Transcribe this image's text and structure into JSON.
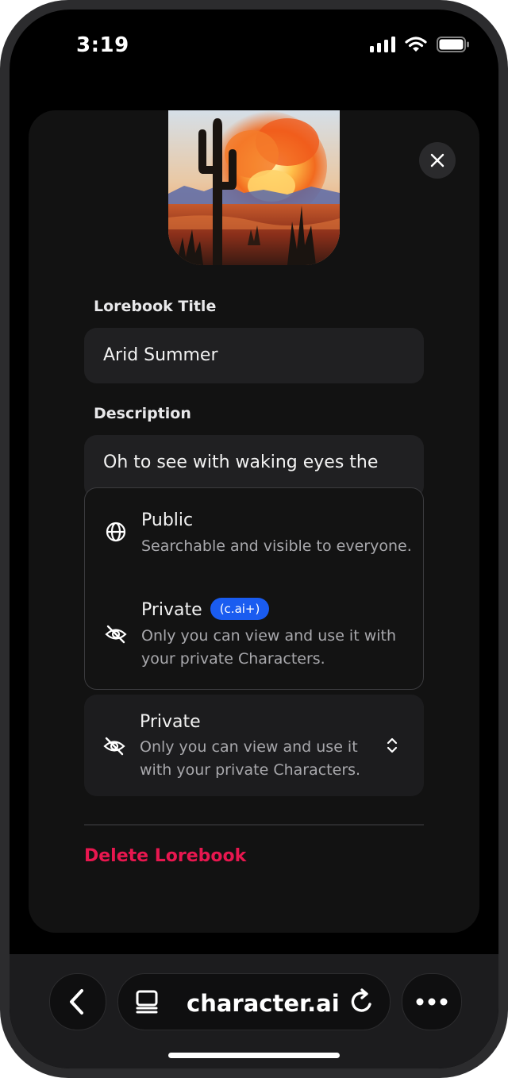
{
  "status_bar": {
    "time": "3:19"
  },
  "sheet": {
    "title_label": "Lorebook Title",
    "title_value": "Arid Summer",
    "description_label": "Description",
    "description_value": "Oh to see with waking eyes the",
    "visibility_options": [
      {
        "title": "Public",
        "description": "Searchable and visible to everyone.",
        "icon": "globe-icon"
      },
      {
        "title": "Private",
        "badge": "(c.ai+)",
        "description": "Only you can view and use it with your private Characters.",
        "icon": "eye-off-icon"
      }
    ],
    "selected_visibility": {
      "title": "Private",
      "description": "Only you can view and use it with your private Characters.",
      "icon": "eye-off-icon"
    },
    "delete_label": "Delete Lorebook",
    "delete_color": "#e8174f",
    "badge_color": "#1a5cf0"
  },
  "browser_bar": {
    "url": "character.ai"
  }
}
